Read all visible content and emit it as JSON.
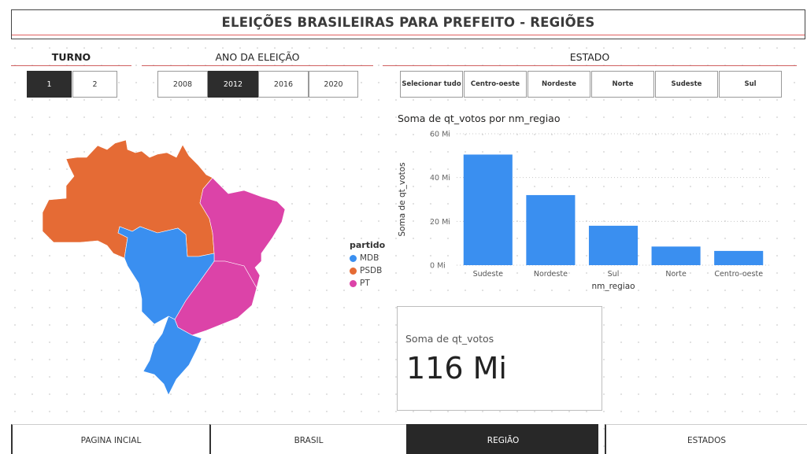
{
  "title": "ELEIÇÕES BRASILEIRAS PARA PREFEITO - REGIÕES",
  "turno": {
    "label": "TURNO",
    "options": [
      "1",
      "2"
    ],
    "selected": "1"
  },
  "ano": {
    "label": "ANO DA ELEIÇÃO",
    "options": [
      "2008",
      "2012",
      "2016",
      "2020"
    ],
    "selected": "2012"
  },
  "estado": {
    "label": "ESTADO",
    "options": [
      "Selecionar tudo",
      "Centro-oeste",
      "Nordeste",
      "Norte",
      "Sudeste",
      "Sul"
    ]
  },
  "map_legend": {
    "title": "partido",
    "items": [
      {
        "name": "MDB",
        "color": "#3a8ff0"
      },
      {
        "name": "PSDB",
        "color": "#e56b35"
      },
      {
        "name": "PT",
        "color": "#dc43a8"
      }
    ]
  },
  "chart_data": {
    "type": "bar",
    "title": "Soma de qt_votos por nm_regiao",
    "xlabel": "nm_regiao",
    "ylabel": "Soma de qt_votos",
    "categories": [
      "Sudeste",
      "Nordeste",
      "Sul",
      "Norte",
      "Centro-oeste"
    ],
    "values": [
      50.5,
      32,
      18,
      8.5,
      6.5
    ],
    "unit": "Mi",
    "ylim": [
      0,
      60
    ],
    "yticks": [
      "0 Mi",
      "20 Mi",
      "40 Mi",
      "60 Mi"
    ],
    "color": "#3a8ff0"
  },
  "card": {
    "label": "Soma de qt_votos",
    "value": "116 Mi"
  },
  "nav": {
    "items": [
      "PAGINA INCIAL",
      "BRASIL",
      "REGIÃO",
      "ESTADOS"
    ],
    "active": "REGIÃO"
  }
}
